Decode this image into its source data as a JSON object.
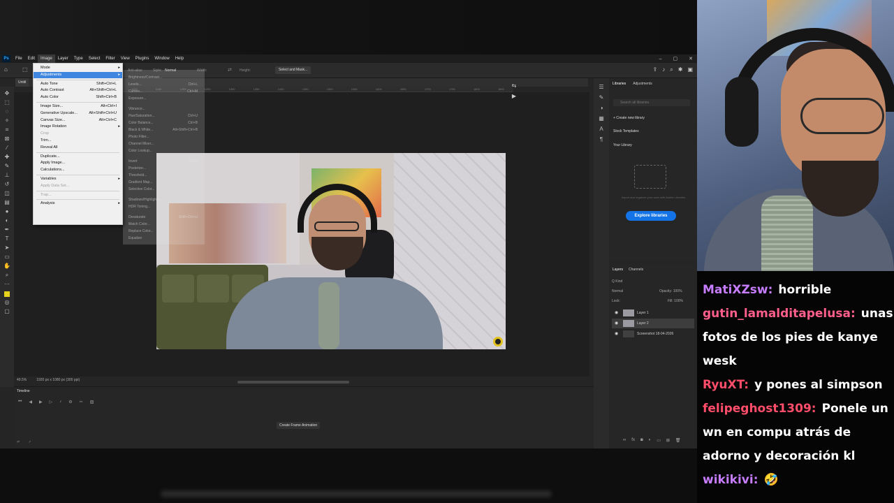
{
  "menubar": {
    "items": [
      "File",
      "Edit",
      "Image",
      "Layer",
      "Type",
      "Select",
      "Filter",
      "View",
      "Plugins",
      "Window",
      "Help"
    ],
    "active": "Image"
  },
  "window_controls": [
    "–",
    "▢",
    "✕"
  ],
  "options": {
    "anti_alias": "Anti-alias",
    "style_label": "Style:",
    "style_value": "Normal",
    "width": "Width:",
    "height": "Height:",
    "select_mask": "Select and Mask..."
  },
  "doc_tab": "Untitl",
  "ruler_ticks": [
    "1100",
    "1150",
    "1200",
    "1250",
    "1300",
    "1350",
    "1400",
    "1450",
    "1500",
    "1550",
    "1600",
    "1650",
    "1700",
    "1750",
    "1800",
    "1850"
  ],
  "image_menu": [
    {
      "label": "Mode",
      "arrow": true
    },
    {
      "label": "Adjustments",
      "arrow": true,
      "highlight": true
    },
    {
      "sep": true
    },
    {
      "label": "Auto Tone",
      "shortcut": "Shift+Ctrl+L"
    },
    {
      "label": "Auto Contrast",
      "shortcut": "Alt+Shift+Ctrl+L"
    },
    {
      "label": "Auto Color",
      "shortcut": "Shift+Ctrl+B"
    },
    {
      "sep": true
    },
    {
      "label": "Image Size...",
      "shortcut": "Alt+Ctrl+I"
    },
    {
      "label": "Generative Upscale...",
      "shortcut": "Alt+Shift+Ctrl+U"
    },
    {
      "label": "Canvas Size...",
      "shortcut": "Alt+Ctrl+C"
    },
    {
      "label": "Image Rotation",
      "arrow": true
    },
    {
      "label": "Crop",
      "disabled": true
    },
    {
      "label": "Trim..."
    },
    {
      "label": "Reveal All"
    },
    {
      "sep": true
    },
    {
      "label": "Duplicate..."
    },
    {
      "label": "Apply Image..."
    },
    {
      "label": "Calculations..."
    },
    {
      "sep": true
    },
    {
      "label": "Variables",
      "arrow": true
    },
    {
      "label": "Apply Data Set...",
      "disabled": true
    },
    {
      "sep": true
    },
    {
      "label": "Trap...",
      "disabled": true
    },
    {
      "sep": true
    },
    {
      "label": "Analysis",
      "arrow": true
    }
  ],
  "adjust_submenu": [
    {
      "label": "Brightness/Contrast..."
    },
    {
      "label": "Levels...",
      "shortcut": "Ctrl+L"
    },
    {
      "label": "Curves...",
      "shortcut": "Ctrl+M"
    },
    {
      "label": "Exposure..."
    },
    {
      "label": ""
    },
    {
      "label": "Vibrance..."
    },
    {
      "label": "Hue/Saturation...",
      "shortcut": "Ctrl+U"
    },
    {
      "label": "Color Balance...",
      "shortcut": "Ctrl+B"
    },
    {
      "label": "Black & White...",
      "shortcut": "Alt+Shift+Ctrl+B"
    },
    {
      "label": "Photo Filter..."
    },
    {
      "label": "Channel Mixer..."
    },
    {
      "label": "Color Lookup..."
    },
    {
      "label": ""
    },
    {
      "label": "Invert",
      "shortcut": "Ctrl+I"
    },
    {
      "label": "Posterize..."
    },
    {
      "label": "Threshold..."
    },
    {
      "label": "Gradient Map..."
    },
    {
      "label": "Selective Color..."
    },
    {
      "label": ""
    },
    {
      "label": "Shadows/Highlights..."
    },
    {
      "label": "HDR Toning..."
    },
    {
      "label": ""
    },
    {
      "label": "Desaturate",
      "shortcut": "Shift+Ctrl+U"
    },
    {
      "label": "Match Color..."
    },
    {
      "label": "Replace Color..."
    },
    {
      "label": "Equalize"
    }
  ],
  "status": {
    "zoom": "49.5%",
    "doc_size": "1920 px x 1080 px (300 ppi)"
  },
  "timeline": {
    "title": "Timeline",
    "create_label": "Create Frame Animation"
  },
  "libraries": {
    "tabs": [
      "Libraries",
      "Adjustments"
    ],
    "search_placeholder": "Search all libraries",
    "create": "+  Create new library",
    "stock": "Stock Templates",
    "your_library": "Your Library",
    "help": "Import and organize your work with Adobe Libraries.",
    "explore": "Explore libraries"
  },
  "layers": {
    "tabs": [
      "Layers",
      "Channels"
    ],
    "kind": "Q Kind",
    "blend": "Normal",
    "opacity": "Opacity: 100%",
    "lock": "Lock:",
    "fill": "Fill: 100%",
    "items": [
      {
        "name": "Layer 1",
        "selected": false
      },
      {
        "name": "Layer 2",
        "selected": true
      },
      {
        "name": "Screenshot 18-04-2026",
        "selected": false
      }
    ]
  },
  "chat": [
    {
      "user": "MatiXZsw:",
      "color": "#c77dff",
      "text": "horrible"
    },
    {
      "user": "gutin_lamalditapelusa:",
      "color": "#ff5f8a",
      "text": "unas fotos de los pies de kanye wesk"
    },
    {
      "user": "RyuXT:",
      "color": "#ff4d6a",
      "text": "y pones al simpson"
    },
    {
      "user": "felipeghost1309:",
      "color": "#ff4d6a",
      "text": "Ponele un wn en compu atrás de adorno y decoración kl"
    },
    {
      "user": "wikikivi:",
      "color": "#c77dff",
      "text": "🤣"
    }
  ]
}
